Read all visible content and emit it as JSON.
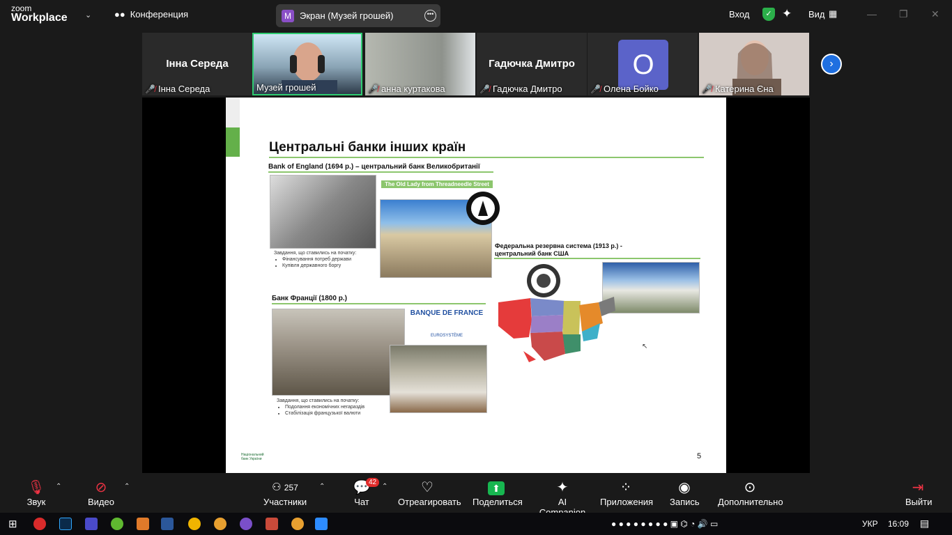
{
  "app": {
    "brand_top": "zoom",
    "brand_bottom": "Workplace"
  },
  "topbar": {
    "conference_label": "Конференция",
    "share_title": "Экран (Музей грошей)",
    "share_initial": "M",
    "login_label": "Вход",
    "view_label": "Вид"
  },
  "participants": [
    {
      "big_name": "Інна Середа",
      "label": "Інна Середа",
      "muted": true
    },
    {
      "big_name": "",
      "label": "Музей грошей",
      "muted": false,
      "active": true
    },
    {
      "big_name": "",
      "label": "анна куртакова",
      "muted": true
    },
    {
      "big_name": "Гадючка Дмитро",
      "label": "Гадючка Дмитро",
      "muted": true
    },
    {
      "big_name": "",
      "label": "Олена Бойко",
      "muted": true,
      "avatar": "О"
    },
    {
      "big_name": "",
      "label": "Катерина Єна",
      "muted": true
    }
  ],
  "slide": {
    "title": "Центральні банки інших країн",
    "boe_heading": "Bank of England (1694 р.) – центральний банк Великобританії",
    "old_lady": "The Old Lady from Threadneedle Street",
    "boe_tasks_title": "Завдання, що ставились на початку:",
    "boe_tasks": [
      "Фінансування потреб держави",
      "Купівля державного боргу"
    ],
    "fed_heading_1": "Федеральна резервна система (1913 р.)  -",
    "fed_heading_2": "центральний банк США",
    "bdf_heading": "Банк Франції (1800 р.)",
    "bdf_logo_1": "BANQUE DE FRANCE",
    "bdf_logo_2": "EUROSYSTÈME",
    "bdf_tasks_title": "Завдання, що ставились на початку:",
    "bdf_tasks": [
      "Подолання економічних негараздів",
      "Стабілізація французької валюти"
    ],
    "page_number": "5",
    "nbu_1": "Національний",
    "nbu_2": "банк України"
  },
  "toolbar": {
    "audio": "Звук",
    "video": "Видео",
    "participants": "Участники",
    "participants_count": "257",
    "chat": "Чат",
    "chat_badge": "42",
    "react": "Отреагировать",
    "share": "Поделиться",
    "ai": "AI Companion",
    "apps": "Приложения",
    "record": "Запись",
    "more": "Дополнительно",
    "leave": "Выйти"
  },
  "taskbar": {
    "lang": "УКР",
    "time": "16:09"
  },
  "colors": {
    "accent_green": "#8cc66d",
    "zoom_share_green": "#17b650",
    "leave_red": "#e02b2b"
  }
}
